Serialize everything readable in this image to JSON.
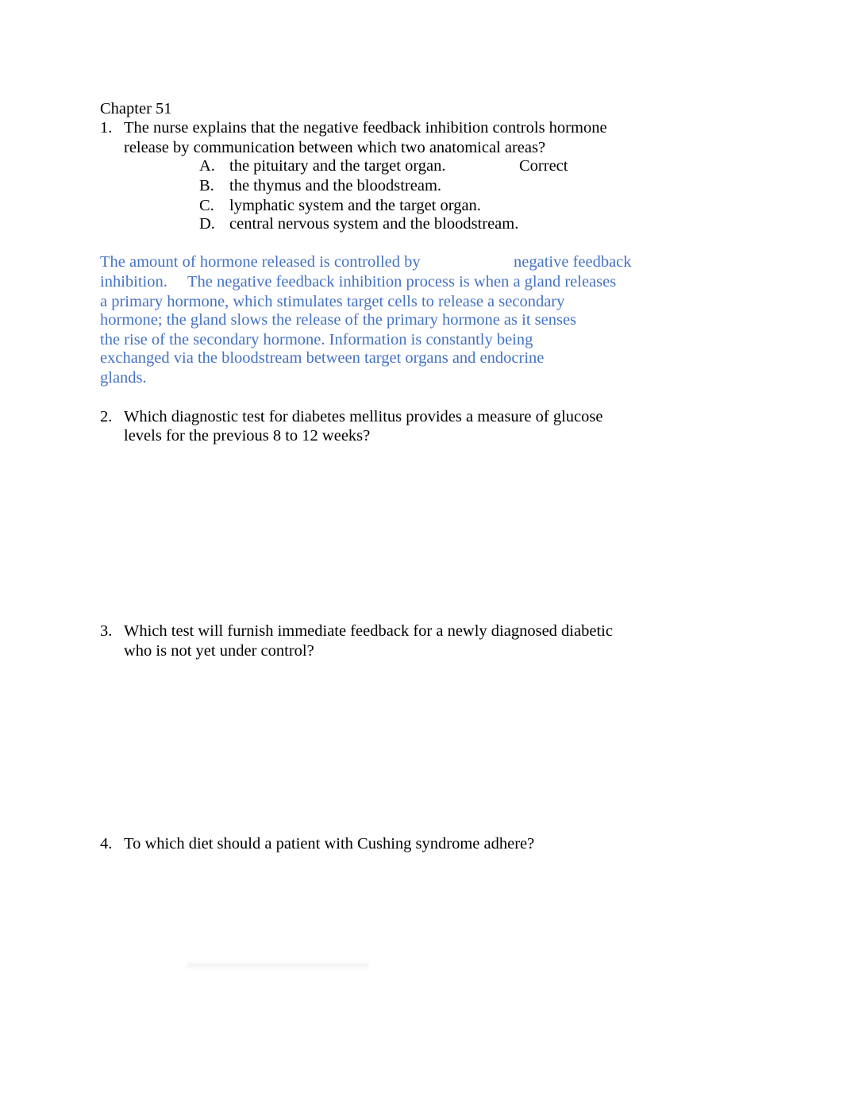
{
  "document": {
    "chapter_title": "Chapter 51",
    "questions": [
      {
        "number": "1.",
        "lines": [
          "The nurse explains that the negative feedback inhibition controls hormone",
          "release by communication between which two anatomical areas?"
        ],
        "options": [
          {
            "letter": "A.",
            "text": "the pituitary and the target organ.",
            "mark": "Correct"
          },
          {
            "letter": "B.",
            "text": "the thymus and the bloodstream."
          },
          {
            "letter": "C.",
            "text": "lymphatic system and the target organ."
          },
          {
            "letter": "D.",
            "text": "central nervous system and the bloodstream."
          }
        ],
        "explanation": [
          "The amount of hormone released is controlled by",
          "negative feedback",
          "inhibition.",
          "The negative feedback inhibition process is when a gland releases",
          "a primary hormone, which stimulates target cells to release a secondary",
          "hormone; the gland slows the release of the primary hormone as it senses",
          "the rise of the secondary hormone. Information is constantly being",
          "exchanged via the bloodstream between target organs and endocrine",
          "glands."
        ]
      },
      {
        "number": "2.",
        "lines": [
          "Which diagnostic test for diabetes mellitus provides a measure of glucose",
          "levels for the previous 8 to 12 weeks?"
        ]
      },
      {
        "number": "3.",
        "lines": [
          "Which test will furnish immediate feedback for a newly diagnosed diabetic",
          "who is not yet under control?"
        ]
      },
      {
        "number": "4.",
        "lines": [
          "To which diet should a patient with Cushing syndrome adhere?"
        ]
      }
    ],
    "colors": {
      "explanation_text": "#4472c4",
      "body_text": "#000000"
    }
  }
}
